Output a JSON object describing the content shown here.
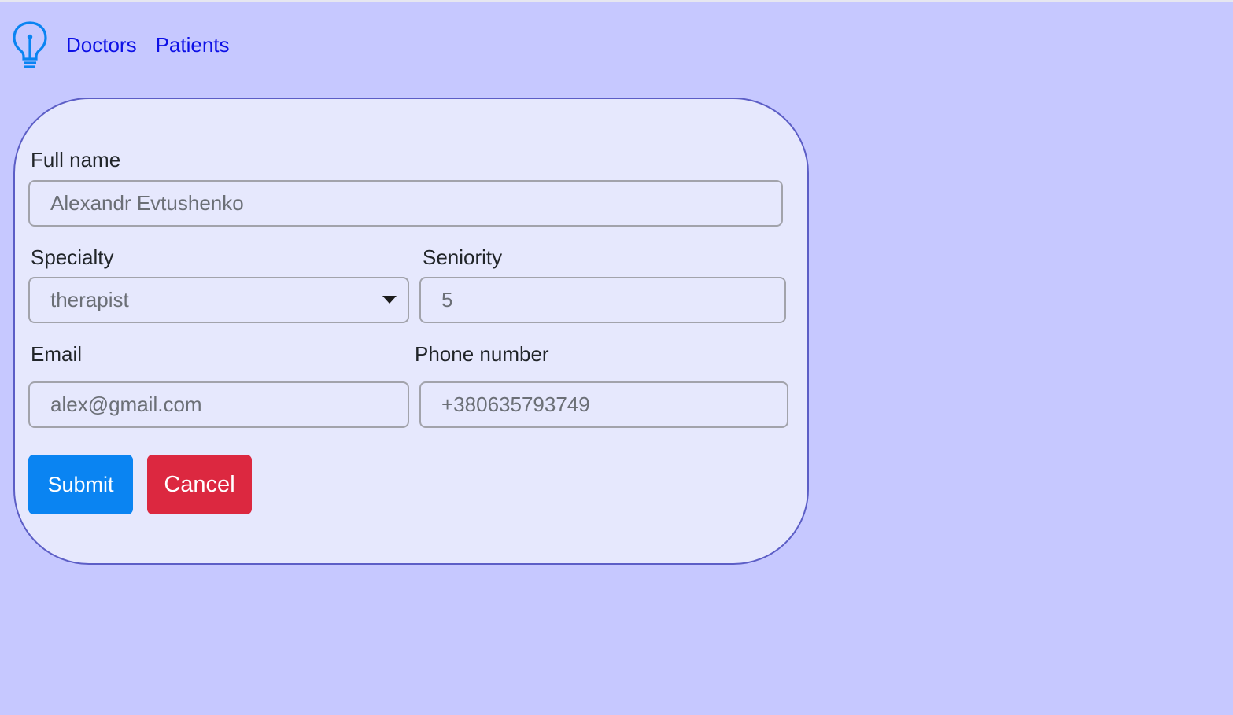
{
  "nav": {
    "logo_icon": "lightbulb-icon",
    "links": [
      "Doctors",
      "Patients"
    ]
  },
  "form": {
    "full_name": {
      "label": "Full name",
      "value": "Alexandr Evtushenko"
    },
    "specialty": {
      "label": "Specialty",
      "value": "therapist"
    },
    "seniority": {
      "label": "Seniority",
      "value": "5"
    },
    "email": {
      "label": "Email",
      "value": "alex@gmail.com"
    },
    "phone": {
      "label": "Phone number",
      "value": "+380635793749"
    },
    "submit_label": "Submit",
    "cancel_label": "Cancel"
  },
  "colors": {
    "background": "#c6c8ff",
    "card": "#e6e8fd",
    "card_border": "#5c5ec6",
    "link": "#0d10e6",
    "logo": "#0a84f2",
    "submit": "#0a84f2",
    "cancel": "#dc2840"
  }
}
